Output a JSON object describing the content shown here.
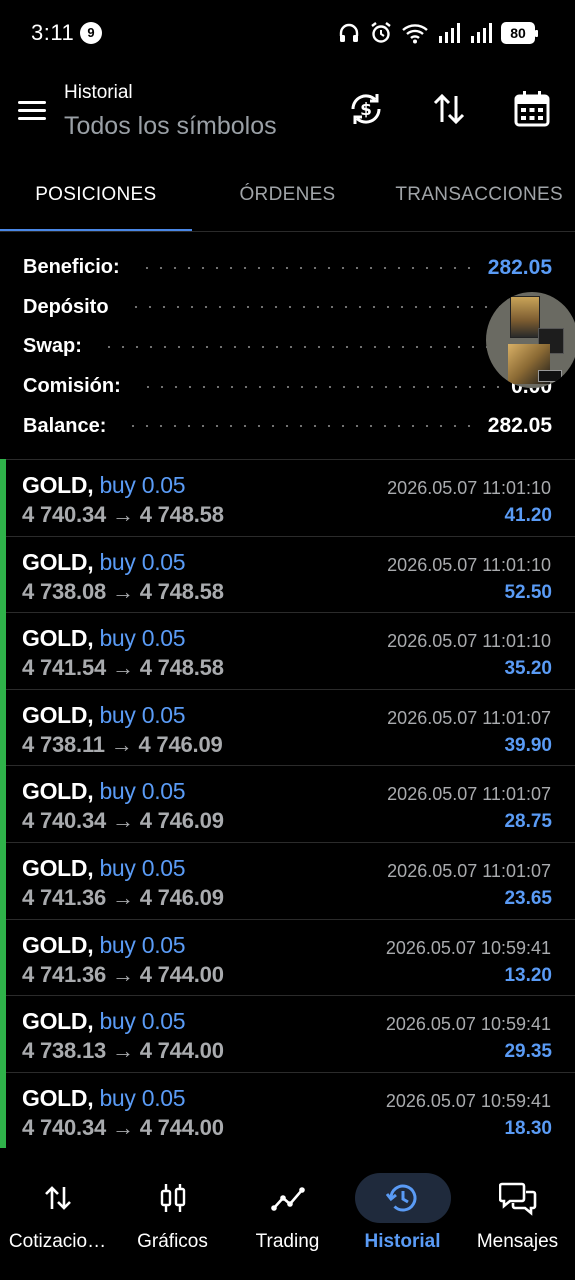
{
  "status_bar": {
    "time": "3:11",
    "notification_count": "9",
    "battery": "80",
    "icons": [
      "headphones-icon",
      "alarm-icon",
      "wifi-icon",
      "signal-icon",
      "signal-icon",
      "battery-icon"
    ]
  },
  "header": {
    "title": "Historial",
    "subtitle": "Todos los símbolos",
    "actions": [
      "currency-sync-icon",
      "sort-icon",
      "calendar-icon"
    ]
  },
  "tabs": [
    {
      "label": "POSICIONES",
      "active": true
    },
    {
      "label": "ÓRDENES",
      "active": false
    },
    {
      "label": "TRANSACCIONES",
      "active": false
    }
  ],
  "summary": [
    {
      "label": "Beneficio:",
      "value": "282.05",
      "highlight": true
    },
    {
      "label": "Depósito",
      "value": ""
    },
    {
      "label": "Swap:",
      "value": ""
    },
    {
      "label": "Comisión:",
      "value": "0.00"
    },
    {
      "label": "Balance:",
      "value": "282.05"
    }
  ],
  "trades": [
    {
      "symbol": "GOLD,",
      "side": "buy 0.05",
      "open": "4 740.34",
      "arrow": "→",
      "close": "4 748.58",
      "time": "2026.05.07 11:01:10",
      "profit": "41.20"
    },
    {
      "symbol": "GOLD,",
      "side": "buy 0.05",
      "open": "4 738.08",
      "arrow": "→",
      "close": "4 748.58",
      "time": "2026.05.07 11:01:10",
      "profit": "52.50"
    },
    {
      "symbol": "GOLD,",
      "side": "buy 0.05",
      "open": "4 741.54",
      "arrow": "→",
      "close": "4 748.58",
      "time": "2026.05.07 11:01:10",
      "profit": "35.20"
    },
    {
      "symbol": "GOLD,",
      "side": "buy 0.05",
      "open": "4 738.11",
      "arrow": "→",
      "close": "4 746.09",
      "time": "2026.05.07 11:01:07",
      "profit": "39.90"
    },
    {
      "symbol": "GOLD,",
      "side": "buy 0.05",
      "open": "4 740.34",
      "arrow": "→",
      "close": "4 746.09",
      "time": "2026.05.07 11:01:07",
      "profit": "28.75"
    },
    {
      "symbol": "GOLD,",
      "side": "buy 0.05",
      "open": "4 741.36",
      "arrow": "→",
      "close": "4 746.09",
      "time": "2026.05.07 11:01:07",
      "profit": "23.65"
    },
    {
      "symbol": "GOLD,",
      "side": "buy 0.05",
      "open": "4 741.36",
      "arrow": "→",
      "close": "4 744.00",
      "time": "2026.05.07 10:59:41",
      "profit": "13.20"
    },
    {
      "symbol": "GOLD,",
      "side": "buy 0.05",
      "open": "4 738.13",
      "arrow": "→",
      "close": "4 744.00",
      "time": "2026.05.07 10:59:41",
      "profit": "29.35"
    },
    {
      "symbol": "GOLD,",
      "side": "buy 0.05",
      "open": "4 740.34",
      "arrow": "→",
      "close": "4 744.00",
      "time": "2026.05.07 10:59:41",
      "profit": "18.30"
    }
  ],
  "bottom_nav": [
    {
      "label": "Cotizacio…",
      "icon": "quotes-arrows-icon",
      "active": false
    },
    {
      "label": "Gráficos",
      "icon": "candlestick-chart-icon",
      "active": false
    },
    {
      "label": "Trading",
      "icon": "trading-line-icon",
      "active": false
    },
    {
      "label": "Historial",
      "icon": "history-icon",
      "active": true
    },
    {
      "label": "Mensajes",
      "icon": "messages-icon",
      "active": false
    }
  ],
  "colors": {
    "accent": "#5a9bf5",
    "tab_indicator": "#4a87e6",
    "profit_bar": "#2fb24a",
    "background": "#000000"
  }
}
